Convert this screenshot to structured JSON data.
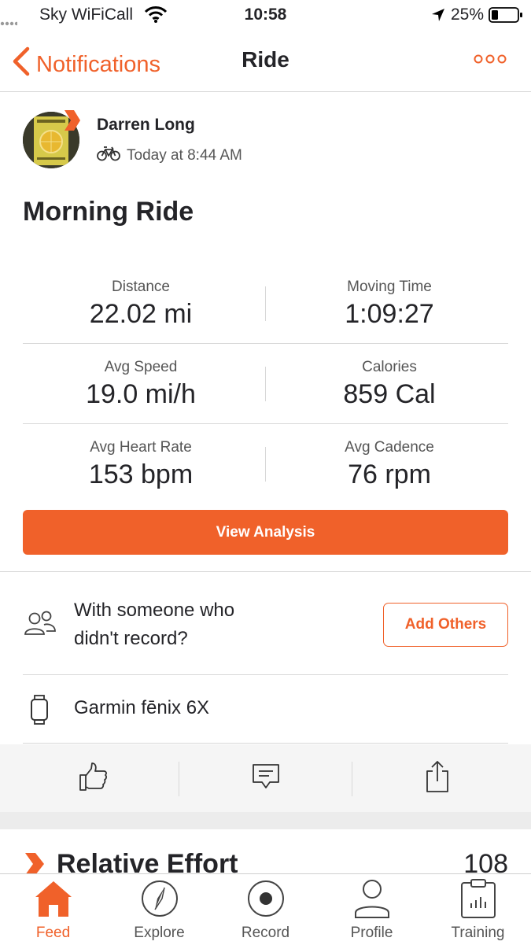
{
  "status_bar": {
    "carrier": "Sky WiFiCall",
    "time": "10:58",
    "battery": "25%"
  },
  "nav": {
    "back_label": "Notifications",
    "title": "Ride",
    "more_icon": "ellipsis-icon"
  },
  "athlete": {
    "name": "Darren Long",
    "timestamp": "Today at 8:44 AM",
    "activity_icon": "bike-icon"
  },
  "activity": {
    "title": "Morning Ride"
  },
  "stats": [
    {
      "label": "Distance",
      "value": "22.02 mi"
    },
    {
      "label": "Moving Time",
      "value": "1:09:27"
    },
    {
      "label": "Avg Speed",
      "value": "19.0 mi/h"
    },
    {
      "label": "Calories",
      "value": "859 Cal"
    },
    {
      "label": "Avg Heart Rate",
      "value": "153 bpm"
    },
    {
      "label": "Avg Cadence",
      "value": "76 rpm"
    }
  ],
  "view_analysis_label": "View Analysis",
  "with_others": {
    "line1": "With someone who",
    "line2": "didn't record?",
    "button": "Add Others"
  },
  "device": {
    "name": "Garmin fēnix 6X"
  },
  "relative_effort": {
    "title": "Relative Effort",
    "value": "108"
  },
  "tabs": [
    {
      "label": "Feed",
      "icon": "home-icon",
      "active": true
    },
    {
      "label": "Explore",
      "icon": "compass-icon",
      "active": false
    },
    {
      "label": "Record",
      "icon": "record-icon",
      "active": false
    },
    {
      "label": "Profile",
      "icon": "profile-icon",
      "active": false
    },
    {
      "label": "Training",
      "icon": "training-icon",
      "active": false
    }
  ],
  "colors": {
    "accent": "#f0612a",
    "text": "#242428",
    "separator": "#d8d8d8"
  }
}
